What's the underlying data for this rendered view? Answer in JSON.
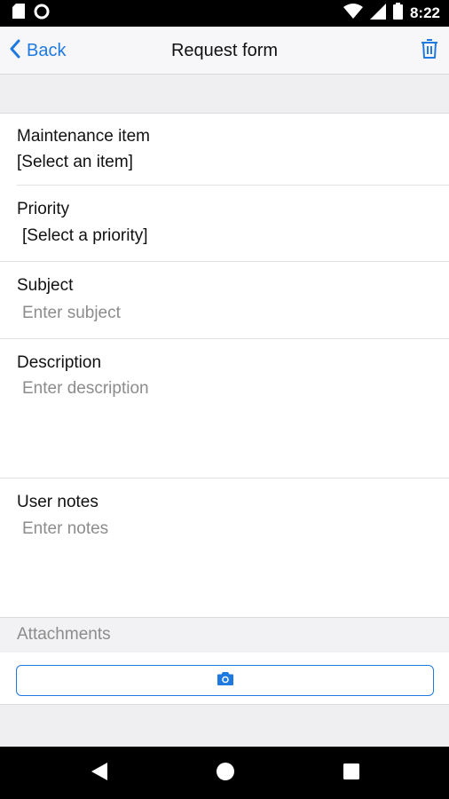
{
  "status_bar": {
    "time": "8:22",
    "left_icons": [
      "sd-card-icon",
      "circle-notification-icon"
    ],
    "right_icons": [
      "wifi-icon",
      "cellular-signal-icon",
      "battery-icon"
    ]
  },
  "header": {
    "back_label": "Back",
    "title": "Request form",
    "accent_color": "#1f7ae0"
  },
  "form": {
    "maintenance_item": {
      "label": "Maintenance item",
      "value": "[Select an item]"
    },
    "priority": {
      "label": "Priority",
      "value": "[Select a priority]"
    },
    "subject": {
      "label": "Subject",
      "placeholder": "Enter subject"
    },
    "description": {
      "label": "Description",
      "placeholder": "Enter description"
    },
    "user_notes": {
      "label": "User notes",
      "placeholder": "Enter notes"
    }
  },
  "attachments": {
    "label": "Attachments",
    "button_icon": "camera-icon"
  },
  "system_nav": {
    "icons": [
      "back-triangle-icon",
      "home-circle-icon",
      "recents-square-icon"
    ]
  }
}
